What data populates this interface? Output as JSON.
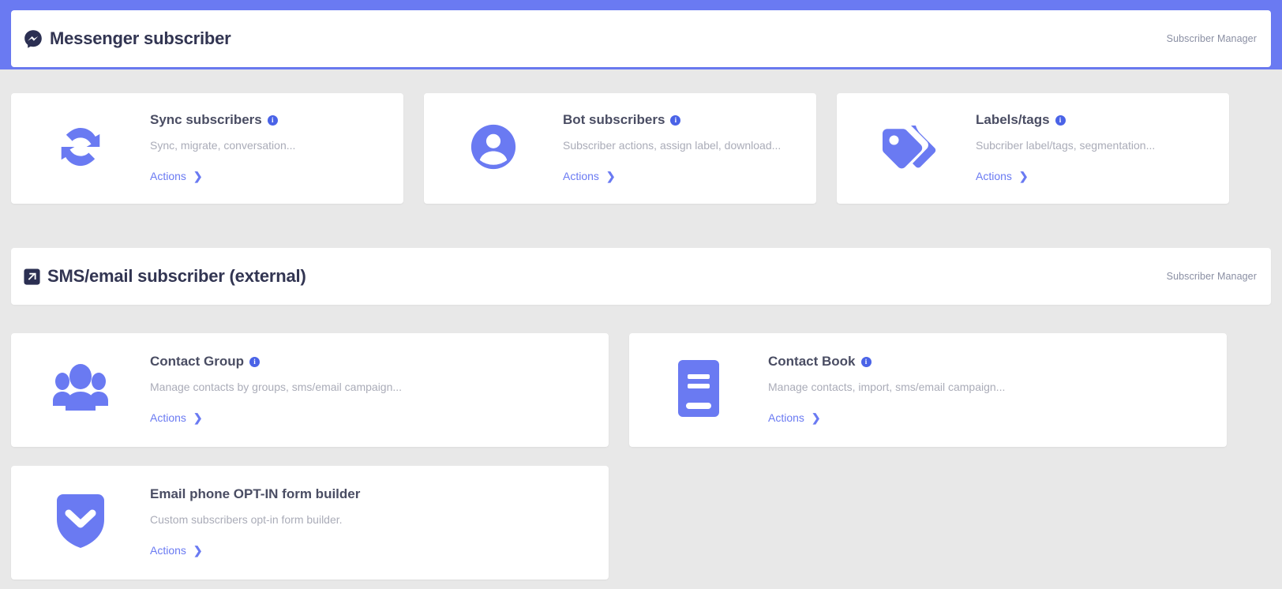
{
  "theme": {
    "accent": "#6a7af2",
    "accent_dark": "#4a63e7",
    "page_bg": "#e8e8e8",
    "card_bg": "#ffffff",
    "title_color": "#323552",
    "muted_color": "#aaacb8"
  },
  "sections": [
    {
      "id": "messenger-subscriber",
      "icon": "messenger-icon",
      "title": "Messenger subscriber",
      "right_label": "Subscriber Manager",
      "rows": [
        {
          "cards": [
            {
              "id": "sync-subscribers",
              "icon": "sync-icon",
              "title": "Sync subscribers",
              "has_info": true,
              "description": "Sync, migrate, conversation...",
              "action_label": "Actions",
              "width": "w3"
            },
            {
              "id": "bot-subscribers",
              "icon": "user-avatar-icon",
              "title": "Bot subscribers",
              "has_info": true,
              "description": "Subscriber actions, assign label, download...",
              "action_label": "Actions",
              "width": "w3"
            },
            {
              "id": "labels-tags",
              "icon": "tags-icon",
              "title": "Labels/tags",
              "has_info": true,
              "description": "Subcriber label/tags, segmentation...",
              "action_label": "Actions",
              "width": "w3"
            }
          ]
        }
      ]
    },
    {
      "id": "sms-email-subscriber",
      "icon": "external-link-icon",
      "title": "SMS/email subscriber (external)",
      "right_label": "Subscriber Manager",
      "rows": [
        {
          "cards": [
            {
              "id": "contact-group",
              "icon": "people-group-icon",
              "title": "Contact Group",
              "has_info": true,
              "description": "Manage contacts by groups, sms/email campaign...",
              "action_label": "Actions",
              "width": "w2"
            },
            {
              "id": "contact-book",
              "icon": "book-icon",
              "title": "Contact Book",
              "has_info": true,
              "description": "Manage contacts, import, sms/email campaign...",
              "action_label": "Actions",
              "width": "w2"
            }
          ]
        },
        {
          "cards": [
            {
              "id": "email-phone-optin-form-builder",
              "icon": "shield-chevron-icon",
              "title": "Email phone OPT-IN form builder",
              "has_info": false,
              "description": "Custom subscribers opt-in form builder.",
              "action_label": "Actions",
              "width": "w2"
            }
          ]
        }
      ]
    }
  ],
  "icons": {
    "info_glyph": "i",
    "chevron_glyph": "❯"
  }
}
